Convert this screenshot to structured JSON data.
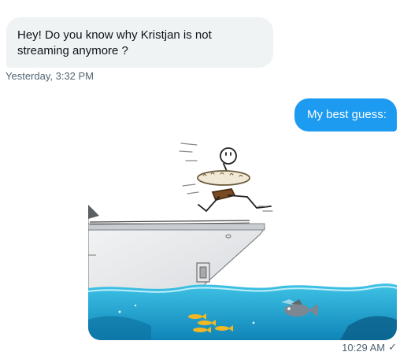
{
  "messages": [
    {
      "direction": "incoming",
      "text": "Hey! Do you know why Kristjan is not streaming anymore ?",
      "timestamp": "Yesterday, 3:32 PM"
    },
    {
      "direction": "outgoing",
      "text": "My best guess:",
      "media": {
        "kind": "image",
        "icon": "meme-image-stick-figure-jumping-off-ship"
      },
      "timestamp": "10:29 AM",
      "status_icon": "seen-check-icon",
      "status_glyph": "✓"
    }
  ],
  "colors": {
    "incoming_bubble": "#eff3f4",
    "outgoing_bubble": "#1d9bf0",
    "meta_text": "#536471"
  }
}
